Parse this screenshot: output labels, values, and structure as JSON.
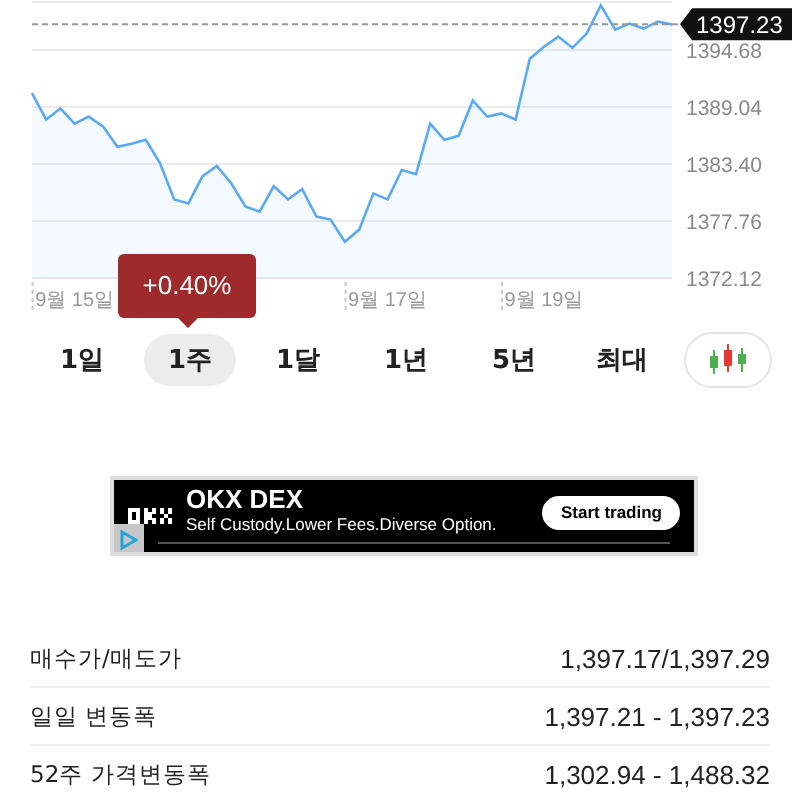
{
  "chart": {
    "chart_data": {
      "type": "area",
      "categories": [
        null,
        null,
        null,
        "9월 15일",
        null,
        null,
        null,
        null,
        null,
        null,
        null,
        null,
        null,
        null,
        null,
        null,
        null,
        null,
        null,
        null,
        null,
        null,
        null,
        null,
        null,
        "9월 17일",
        null,
        null,
        null,
        null,
        null,
        null,
        null,
        null,
        null,
        null,
        "9월 19일",
        null,
        null,
        null,
        null,
        null,
        null,
        null,
        null,
        null
      ],
      "grid": true,
      "ylim": [
        1372.12,
        1399.43
      ],
      "series": [
        {
          "color": "#5aa9f5",
          "values": [
            1390.4,
            1387.8,
            1388.9,
            1387.4,
            1388.1,
            1387.1,
            1385.1,
            1385.4,
            1385.8,
            1383.5,
            1379.9,
            1379.5,
            1382.2,
            1383.2,
            1381.5,
            1379.2,
            1378.7,
            1381.2,
            1379.9,
            1380.9,
            1378.2,
            1377.9,
            1375.7,
            1376.9,
            1380.5,
            1379.9,
            1382.8,
            1382.4,
            1387.4,
            1385.8,
            1386.2,
            1389.7,
            1388.1,
            1388.4,
            1387.8,
            1393.8,
            1395.0,
            1396.0,
            1394.9,
            1396.3,
            1399.1,
            1396.7,
            1397.3,
            1396.8,
            1397.5,
            1397.2
          ]
        }
      ],
      "yticks": [
        {
          "value": 1372.12,
          "label": "1372.12"
        },
        {
          "value": 1377.76,
          "label": "1377.76"
        },
        {
          "value": 1383.4,
          "label": "1383.40"
        },
        {
          "value": 1389.04,
          "label": "1389.04"
        },
        {
          "value": 1394.68,
          "label": "1394.68"
        }
      ],
      "ref_lines": [
        {
          "axis": "y",
          "value": 1397.23,
          "label": "1397.23"
        }
      ]
    },
    "tooltip": "+0.40%"
  },
  "periods": [
    {
      "label": "1일",
      "selected": false
    },
    {
      "label": "1주",
      "selected": true
    },
    {
      "label": "1달",
      "selected": false
    },
    {
      "label": "1년",
      "selected": false
    },
    {
      "label": "5년",
      "selected": false
    },
    {
      "label": "최대",
      "selected": false
    }
  ],
  "ad": {
    "title": "OKX DEX",
    "tagline": "Self Custody.Lower Fees.Diverse Option.",
    "button": "Start trading"
  },
  "stats": [
    {
      "label": "매수가/매도가",
      "value": "1,397.17/1,397.29"
    },
    {
      "label": "일일 변동폭",
      "value": "1,397.21 - 1,397.23"
    },
    {
      "label": "52주 가격변동폭",
      "value": "1,302.94 - 1,488.32"
    }
  ]
}
